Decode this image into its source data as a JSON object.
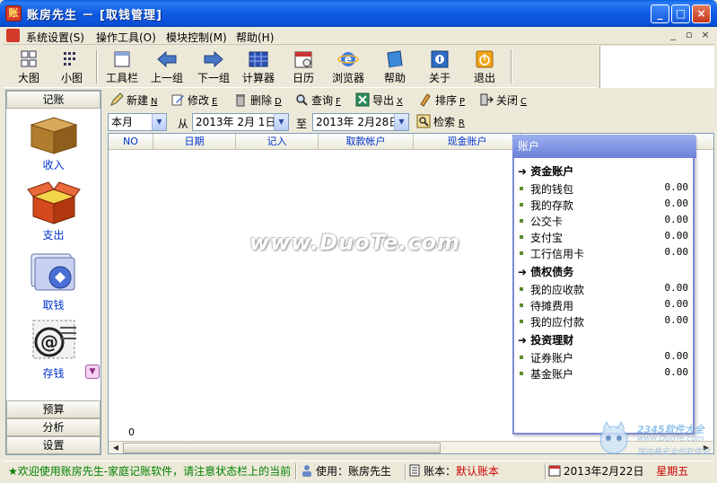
{
  "window": {
    "title": "账房先生 － [取钱管理]",
    "minimize": "_",
    "maximize": "□",
    "close": "×"
  },
  "menu": {
    "items": [
      "系统设置(S)",
      "操作工具(O)",
      "模块控制(M)",
      "帮助(H)"
    ],
    "mdi_buttons": [
      "_",
      "▫",
      "×"
    ]
  },
  "toolbar": {
    "buttons": [
      "大图",
      "小图",
      "工具栏",
      "上一组",
      "下一组",
      "计算器",
      "日历",
      "浏览器",
      "帮助",
      "关于",
      "退出"
    ]
  },
  "leftnav": {
    "top_header": "记账",
    "items": [
      "收入",
      "支出",
      "取钱",
      "存钱"
    ],
    "bottom_headers": [
      "预算",
      "分析",
      "设置"
    ],
    "scroll_icon": "chevron-down-icon"
  },
  "toolbar2": {
    "new": "新建",
    "new_key": "N",
    "edit": "修改",
    "edit_key": "E",
    "delete": "删除",
    "delete_key": "D",
    "query": "查询",
    "query_key": "F",
    "export": "导出",
    "export_key": "X",
    "sort": "排序",
    "sort_key": "P",
    "close": "关闭",
    "close_key": "C"
  },
  "filter": {
    "period": "本月",
    "from_label": "从",
    "from_date": "2013年 2月 1日",
    "to_label": "至",
    "to_date": "2013年 2月28日",
    "search": "检索",
    "search_key": "R"
  },
  "grid": {
    "columns": [
      "NO",
      "日期",
      "记入",
      "取款帐户",
      "现金账户"
    ],
    "count": "0"
  },
  "accounts": {
    "title": "账户",
    "groups": [
      {
        "name": "资金账户",
        "rows": [
          {
            "label": "我的钱包",
            "amount": "0.00"
          },
          {
            "label": "我的存款",
            "amount": "0.00"
          },
          {
            "label": "公交卡",
            "amount": "0.00"
          },
          {
            "label": "支付宝",
            "amount": "0.00"
          },
          {
            "label": "工行信用卡",
            "amount": "0.00"
          }
        ]
      },
      {
        "name": "债权债务",
        "rows": [
          {
            "label": "我的应收款",
            "amount": "0.00"
          },
          {
            "label": "待摊费用",
            "amount": "0.00"
          },
          {
            "label": "我的应付款",
            "amount": "0.00"
          }
        ]
      },
      {
        "name": "投资理财",
        "rows": [
          {
            "label": "证券账户",
            "amount": "0.00"
          },
          {
            "label": "基金账户",
            "amount": "0.00"
          }
        ]
      }
    ]
  },
  "watermark": {
    "center": "www.DuoTe.com",
    "logo_text": "2345软件大全",
    "logo_url": "www.DuoTe.com",
    "logo_sub": "国内最安全的软件站"
  },
  "status": {
    "message": "★欢迎使用账房先生-家庭记账软件，请注意状态栏上的当前",
    "user_label": "使用：",
    "user": "账房先生",
    "ledger_label": "账本：",
    "ledger": "默认账本",
    "date": "2013年2月22日",
    "weekday": "星期五"
  },
  "colors": {
    "titlebar": "#0a50d6",
    "link_blue": "#0033cc",
    "status_red": "#cc0000",
    "status_green": "#008000",
    "panel_header": "#7b8cd6"
  }
}
